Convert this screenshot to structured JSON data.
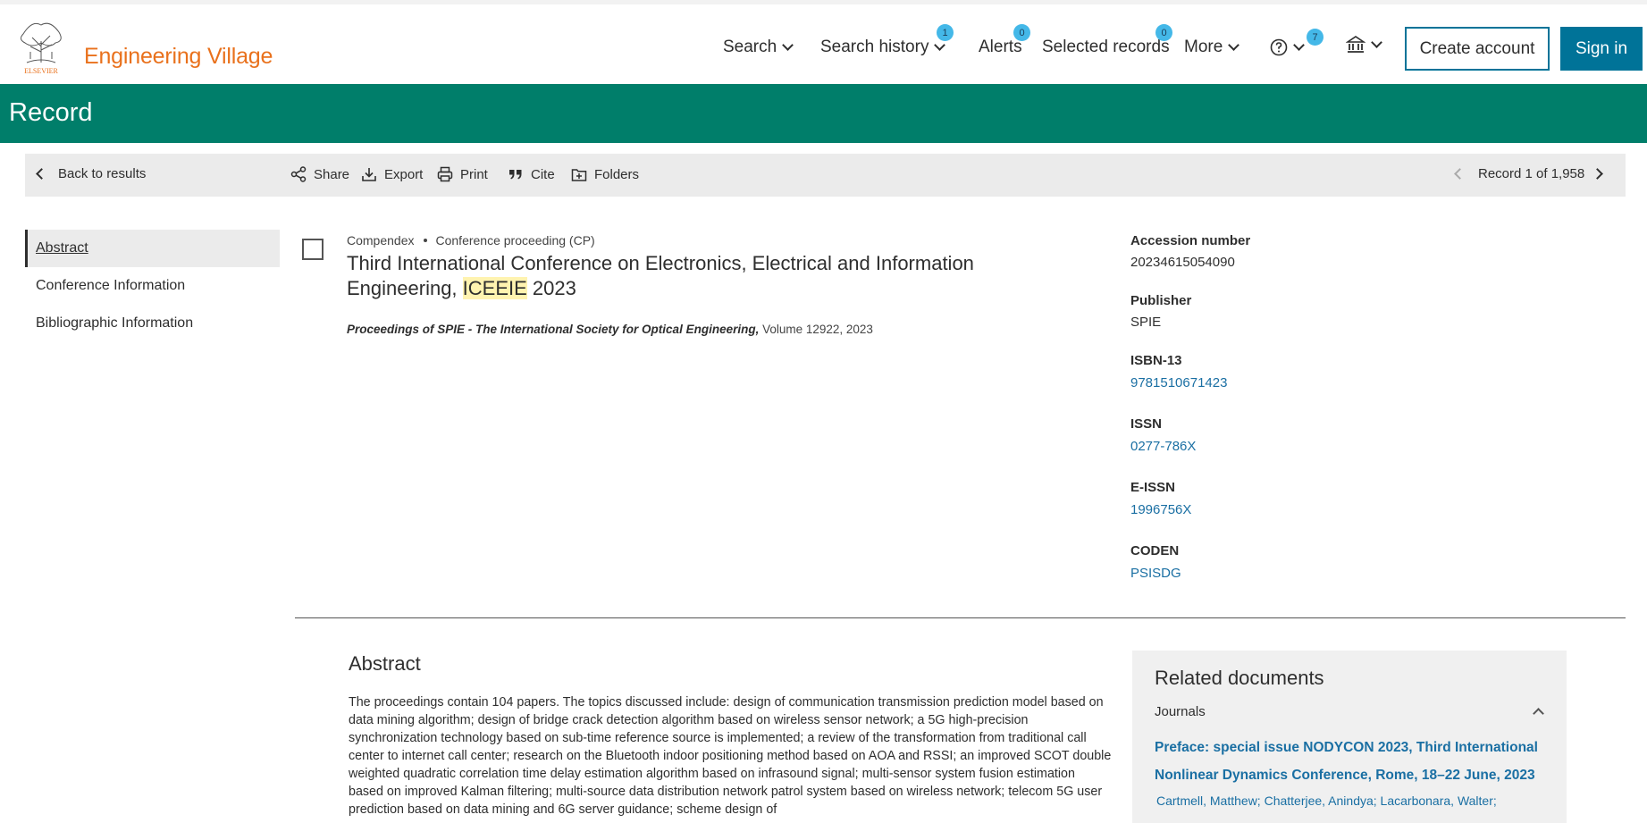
{
  "header": {
    "logo_text": "ELSEVIER",
    "brand": "Engineering Village",
    "nav": {
      "search": "Search",
      "search_history": "Search history",
      "search_history_badge": "1",
      "alerts": "Alerts",
      "alerts_badge": "0",
      "selected_records": "Selected records",
      "selected_records_badge": "0",
      "more": "More",
      "help_badge": "7"
    },
    "create_account": "Create account",
    "sign_in": "Sign in"
  },
  "record_bar": {
    "title": "Record"
  },
  "toolbar": {
    "back": "Back to results",
    "share": "Share",
    "export": "Export",
    "print": "Print",
    "cite": "Cite",
    "folders": "Folders",
    "record_position": "Record 1 of 1,958"
  },
  "sidebar": {
    "items": [
      {
        "label": "Abstract"
      },
      {
        "label": "Conference Information"
      },
      {
        "label": "Bibliographic Information"
      }
    ]
  },
  "record": {
    "database": "Compendex",
    "doc_type": "Conference proceeding (CP)",
    "title_prefix": "Third International Conference on Electronics, Electrical and Information Engineering, ",
    "title_highlight": "ICEEIE",
    "title_suffix": " 2023",
    "source_title": "Proceedings of SPIE - The International Society for Optical Engineering,",
    "source_details": " Volume 12922, 2023"
  },
  "metadata": {
    "accession_label": "Accession number",
    "accession_value": "20234615054090",
    "publisher_label": "Publisher",
    "publisher_value": "SPIE",
    "isbn_label": "ISBN-13",
    "isbn_value": "9781510671423",
    "issn_label": "ISSN",
    "issn_value": "0277-786X",
    "eissn_label": "E-ISSN",
    "eissn_value": "1996756X",
    "coden_label": "CODEN",
    "coden_value": "PSISDG"
  },
  "abstract": {
    "heading": "Abstract",
    "text": "The proceedings contain 104 papers. The topics discussed include: design of communication transmission prediction model based on data mining algorithm; design of bridge crack detection algorithm based on wireless sensor network; a 5G high-precision synchronization technology based on sub-time reference source is implemented; a review of the transformation from traditional call center to internet call center; research on the Bluetooth indoor positioning method based on AOA and RSSI; an improved SCOT double weighted quadratic correlation time delay estimation algorithm based on infrasound signal; multi-sensor system fusion estimation based on improved Kalman filtering; multi-source data distribution network patrol system based on wireless network; telecom 5G user prediction based on data mining and 6G server guidance; scheme design of"
  },
  "related": {
    "heading": "Related documents",
    "category": "Journals",
    "link": "Preface: special issue NODYCON 2023, Third International Nonlinear Dynamics Conference, Rome, 18–22 June, 2023",
    "authors": "Cartmell, Matthew; Chatterjee, Anindya; Lacarbonara, Walter;"
  },
  "colors": {
    "brand_orange": "#e9711c",
    "record_bar": "#007e6a",
    "primary_button": "#007398",
    "link": "#1a6fa3",
    "badge": "#44b8e8"
  }
}
